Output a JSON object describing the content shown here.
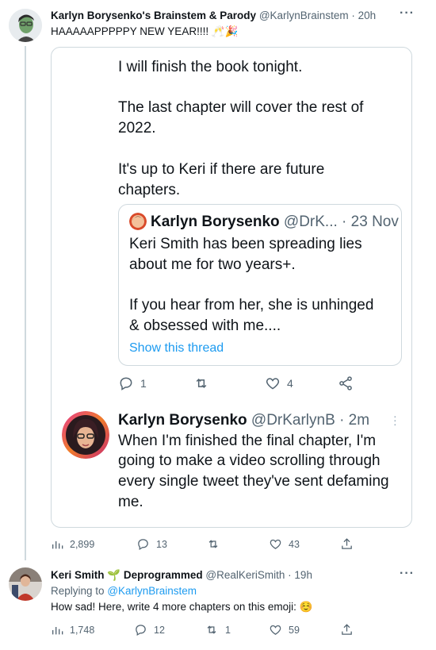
{
  "tweet1": {
    "name": "Karlyn Borysenko's Brainstem & Parody",
    "handle": "@KarlynBrainstem",
    "time": "20h",
    "text": "HAAAAAPPPPPY NEW YEAR!!!!",
    "emoji": "🥂🎉"
  },
  "card": {
    "line1": "I will finish the book tonight.",
    "line2a": "The last chapter will cover the rest of",
    "line2b": "2022.",
    "line3a": "It's up to Keri if there are future",
    "line3b": "chapters.",
    "quote": {
      "name": "Karlyn Borysenko",
      "handle": "@DrK...",
      "date": "23 Nov",
      "line1": "Keri Smith has been spreading lies",
      "line2": "about me for two years+.",
      "line3": "If you hear from her, she is unhinged",
      "line4": "& obsessed with me....",
      "show_thread": "Show this thread"
    },
    "actions": {
      "replies": "1",
      "retweets": "",
      "likes": "4"
    },
    "reply": {
      "name": "Karlyn Borysenko",
      "handle": "@DrKarlynB",
      "time": "2m",
      "line1": "When I'm finished the final chapter, I'm",
      "line2": "going to make a video scrolling through",
      "line3": "every single tweet they've sent defaming",
      "line4": "me."
    }
  },
  "tweet1_actions": {
    "views": "2,899",
    "replies": "13",
    "retweets": "",
    "likes": "43"
  },
  "tweet2": {
    "name": "Keri Smith",
    "name_emoji": "🌱",
    "name_suffix": "Deprogrammed",
    "handle": "@RealKeriSmith",
    "time": "19h",
    "replying_to_label": "Replying to",
    "replying_to_handle": "@KarlynBrainstem",
    "text": "How sad! Here, write 4 more chapters on this emoji:",
    "emoji": "☺️"
  },
  "tweet2_actions": {
    "views": "1,748",
    "replies": "12",
    "retweets": "1",
    "likes": "59"
  }
}
